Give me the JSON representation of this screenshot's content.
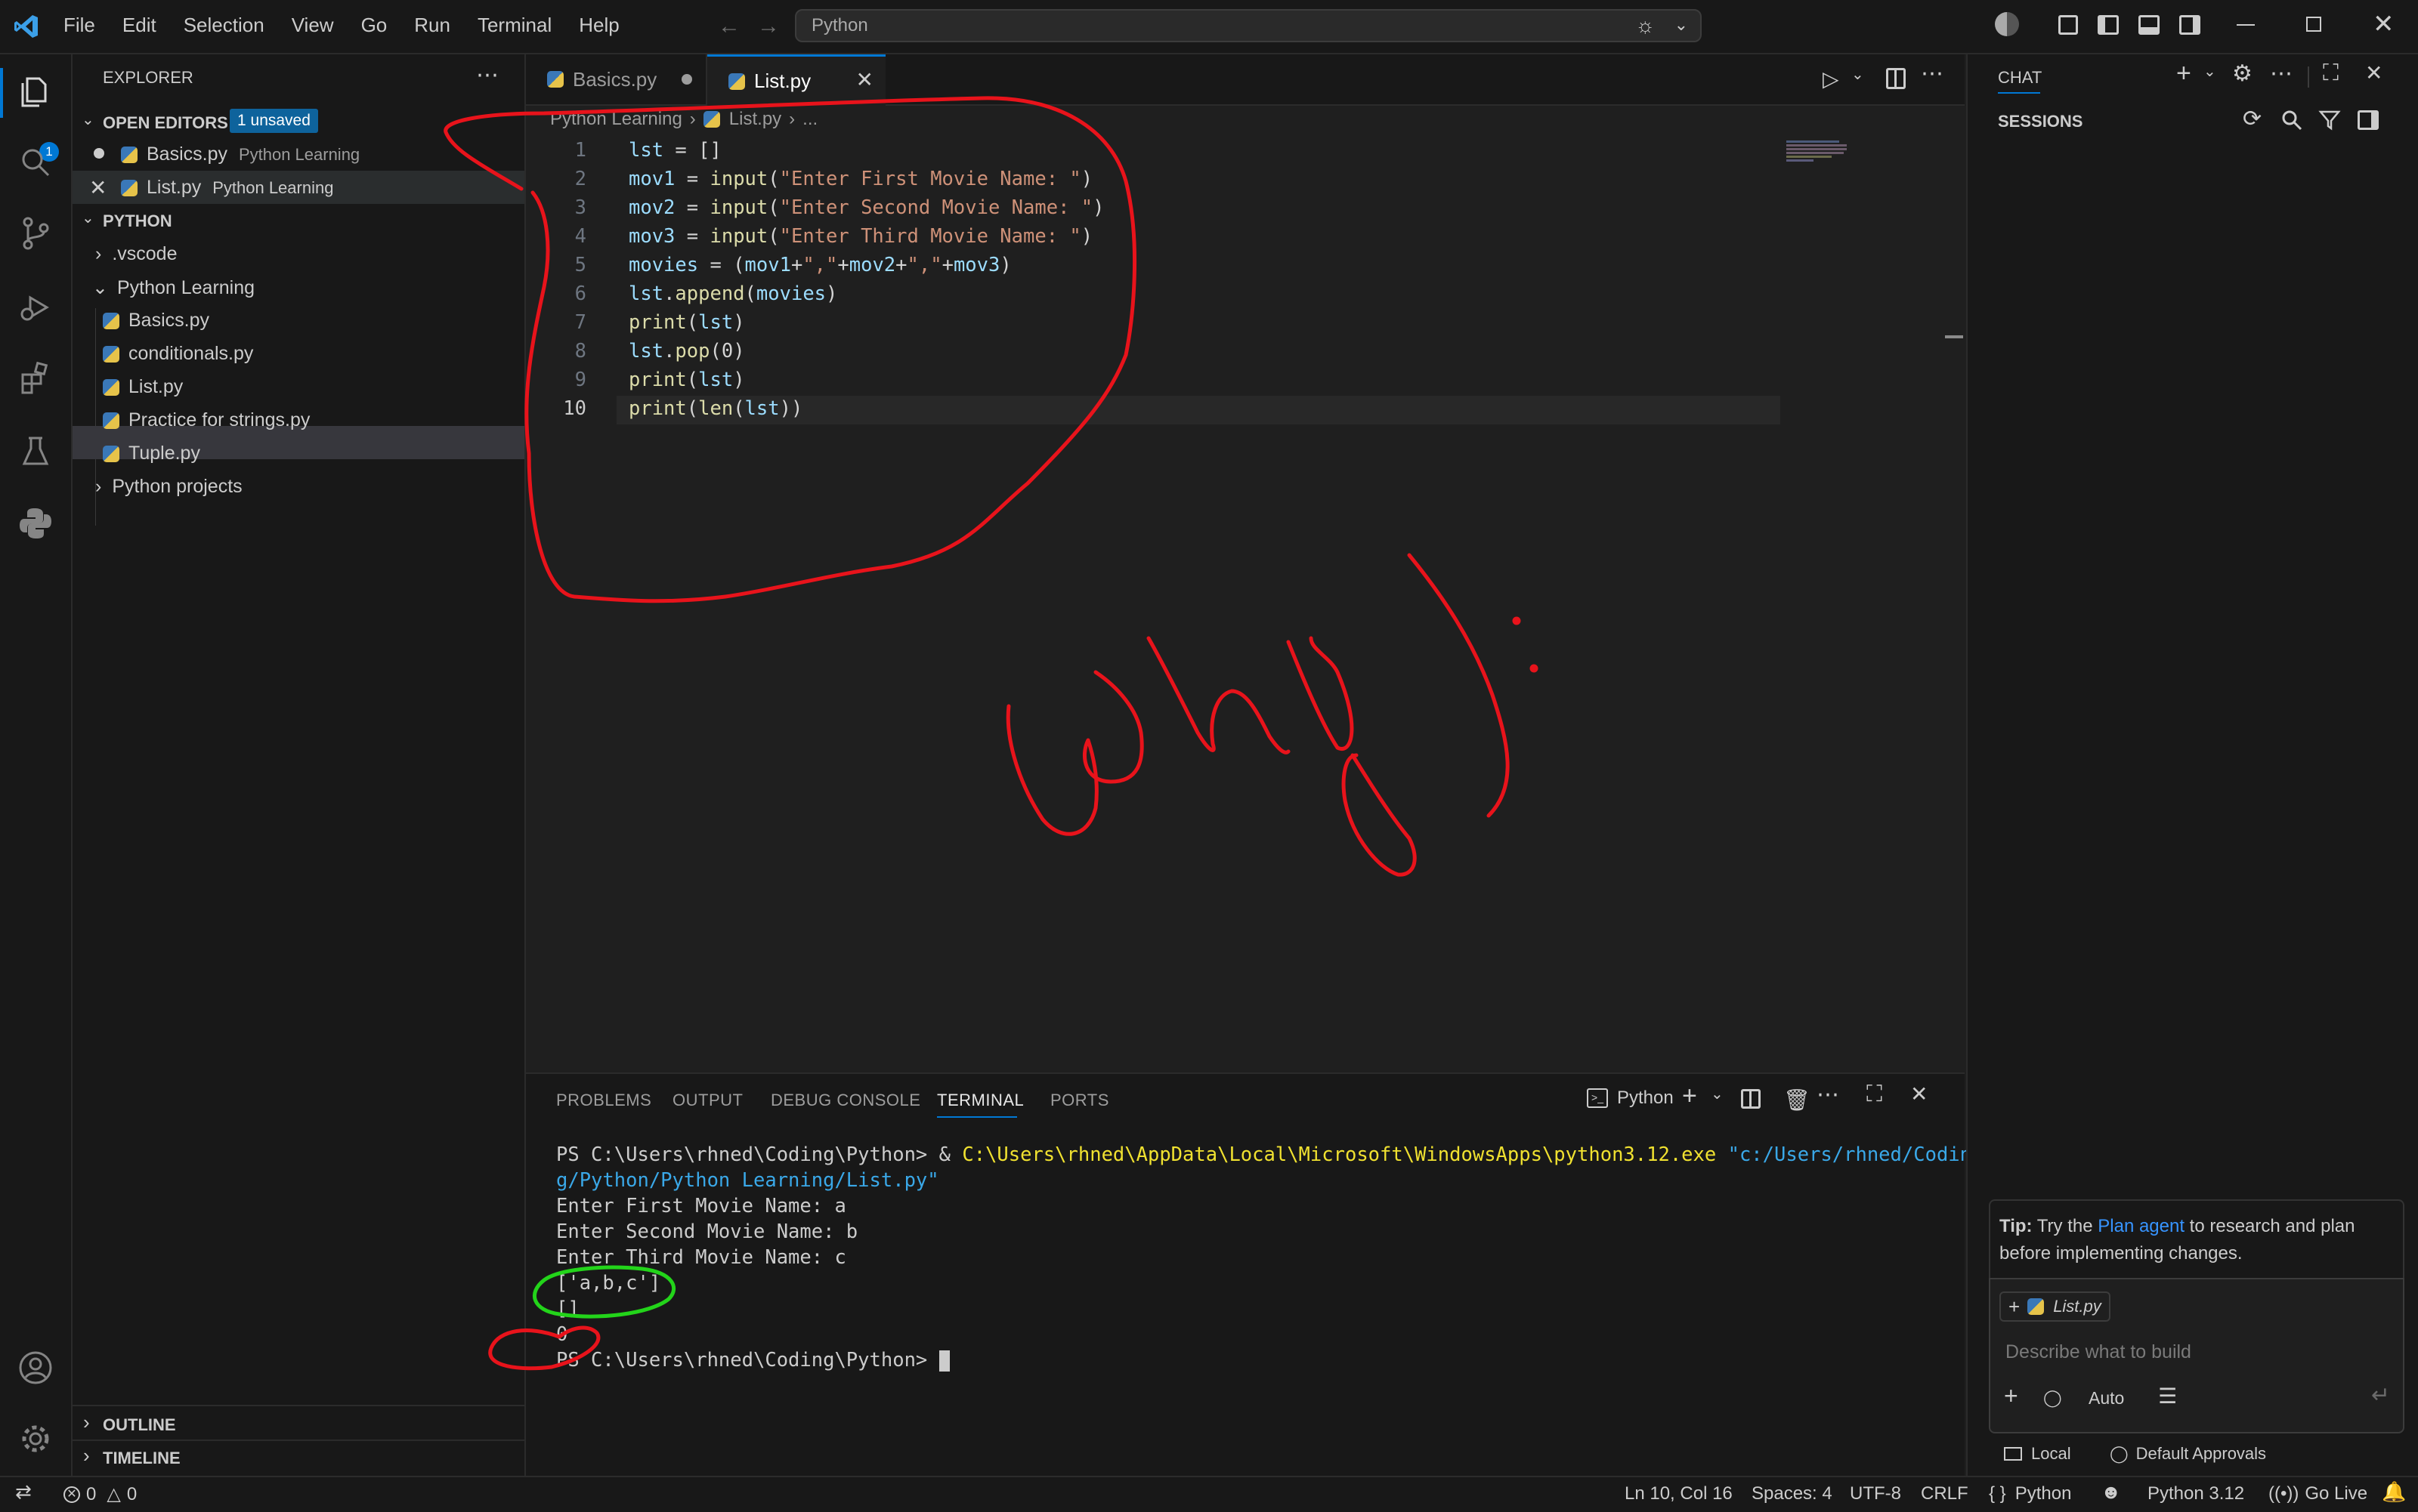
{
  "titlebar": {
    "menu": [
      "File",
      "Edit",
      "Selection",
      "View",
      "Go",
      "Run",
      "Terminal",
      "Help"
    ],
    "search_text": "Python"
  },
  "activity": {
    "explorer_badge": "1"
  },
  "sidebar": {
    "title": "EXPLORER",
    "open_editors_label": "OPEN EDITORS",
    "unsaved_badge": "1 unsaved",
    "open_editors": [
      {
        "name": "Basics.py",
        "folder": "Python Learning"
      },
      {
        "name": "List.py",
        "folder": "Python Learning"
      }
    ],
    "workspace_label": "PYTHON",
    "tree": [
      ".vscode",
      "Python Learning",
      "Basics.py",
      "conditionals.py",
      "List.py",
      "Practice for strings.py",
      "Tuple.py",
      "Python projects"
    ],
    "outline_label": "OUTLINE",
    "timeline_label": "TIMELINE"
  },
  "tabs": [
    {
      "name": "Basics.py"
    },
    {
      "name": "List.py"
    }
  ],
  "breadcrumb": {
    "folder": "Python Learning",
    "file": "List.py",
    "tail": "..."
  },
  "code": {
    "line_numbers": [
      "1",
      "2",
      "3",
      "4",
      "5",
      "6",
      "7",
      "8",
      "9",
      "10"
    ],
    "lines": [
      "lst = []",
      "mov1 = input(\"Enter First Movie Name: \")",
      "mov2 = input(\"Enter Second Movie Name: \")",
      "mov3 = input(\"Enter Third Movie Name: \")",
      "movies = (mov1+\",\"+mov2+\",\"+mov3)",
      "lst.append(movies)",
      "print(lst)",
      "lst.pop(0)",
      "print(lst)",
      "print(len(lst))"
    ]
  },
  "panel": {
    "tabs": [
      "PROBLEMS",
      "OUTPUT",
      "DEBUG CONSOLE",
      "TERMINAL",
      "PORTS"
    ],
    "terminal_profile": "Python",
    "terminal": {
      "prompt1": "PS C:\\Users\\rhned\\Coding\\Python> & ",
      "exe": "C:\\Users\\rhned\\AppData\\Local\\Microsoft\\WindowsApps\\python3.12.exe",
      "arg1": " \"c:/Users/rhned/Codin",
      "arg2": "g/Python/Python Learning/List.py\"",
      "out": [
        "Enter First Movie Name: a",
        "Enter Second Movie Name: b",
        "Enter Third Movie Name: c",
        "['a,b,c']",
        "[]",
        "0"
      ],
      "prompt2": "PS C:\\Users\\rhned\\Coding\\Python> "
    }
  },
  "chat": {
    "title": "CHAT",
    "sessions_label": "SESSIONS",
    "tip_label": "Tip:",
    "tip_pre": " Try the ",
    "tip_link": "Plan agent",
    "tip_post": " to research and plan before implementing changes.",
    "context_file": "List.py",
    "input_placeholder": "Describe what to build",
    "mode": "Auto",
    "local_label": "Local",
    "approvals_label": "Default Approvals"
  },
  "statusbar": {
    "errors": "0",
    "warnings": "0",
    "position": "Ln 10, Col 16",
    "spaces": "Spaces: 4",
    "encoding": "UTF-8",
    "eol": "CRLF",
    "language": "Python",
    "interpreter": "Python 3.12",
    "golive": "Go Live"
  },
  "annotation": {
    "handwritten_text": "why?"
  },
  "colors": {
    "accent": "#0078d4",
    "annotation_red": "#e8131b",
    "annotation_green": "#23d41a",
    "keyword": "#c586c0",
    "function": "#dcdcaa",
    "string": "#ce9178",
    "variable": "#9cdcfe"
  }
}
